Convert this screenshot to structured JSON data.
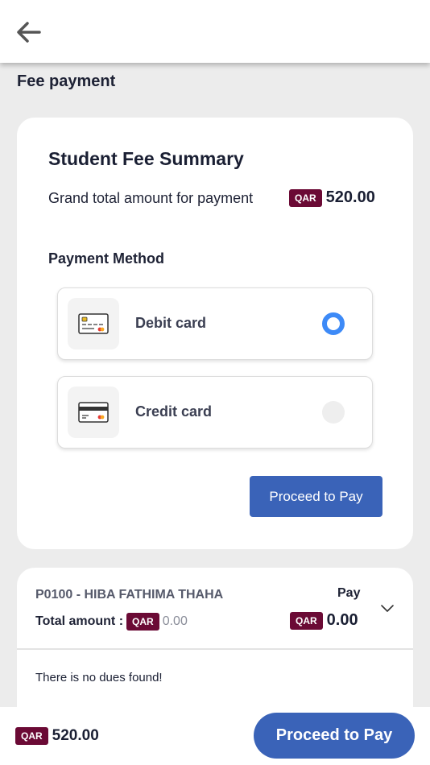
{
  "header": {
    "back_icon": "arrow-left-icon"
  },
  "page": {
    "title": "Fee payment"
  },
  "summary": {
    "title": "Student Fee Summary",
    "grand_total_label": "Grand total amount for payment",
    "currency": "QAR",
    "grand_total_value": "520.00"
  },
  "payment": {
    "title": "Payment Method",
    "methods": [
      {
        "label": "Debit card",
        "icon": "debit-card-icon",
        "selected": true
      },
      {
        "label": "Credit card",
        "icon": "credit-card-icon",
        "selected": false
      }
    ],
    "proceed_label": "Proceed to Pay"
  },
  "student": {
    "name": "P0100 - HIBA FATHIMA THAHA",
    "pay_label": "Pay",
    "total_label": "Total amount :",
    "currency": "QAR",
    "total_value": "0.00",
    "pay_value": "0.00",
    "no_dues": "There is no dues found!"
  },
  "footer": {
    "currency": "QAR",
    "amount": "520.00",
    "proceed_label": "Proceed to Pay"
  },
  "colors": {
    "accent": "#3a63b8",
    "currency_badge": "#6b0a35",
    "radio_selected": "#3d8af7"
  }
}
